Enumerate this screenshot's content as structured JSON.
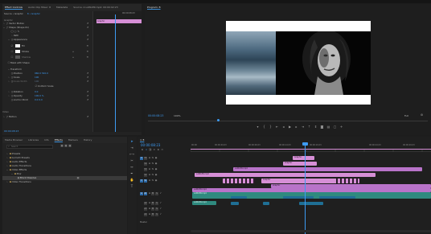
{
  "effect_controls": {
    "tabs": [
      "Effect Controls",
      "Audio Clip Mixer: 8",
      "Metadata",
      "Source: A LAWLER.mp4: 00:00:02:23"
    ],
    "source_label": "Source • Graphic",
    "sequence_label": "8 • Graphic",
    "mini_timecode": "00:00:08:23",
    "mini_clip_label": "Graphic",
    "section_label": "Graphic",
    "rows": [
      {
        "label": "Vector Motion"
      },
      {
        "label": "Shape (Shape 01)"
      },
      {
        "label": "Path"
      },
      {
        "label": "Appearance"
      },
      {
        "label": "Fill"
      },
      {
        "label": "Stroke"
      },
      {
        "label": "Shadow"
      },
      {
        "label": "Mask with Shape"
      },
      {
        "label": "Transform"
      },
      {
        "label": "Position",
        "value": "960.0  540.0"
      },
      {
        "label": "Scale",
        "value": "100"
      },
      {
        "label": "Scale Width",
        "value": "100"
      },
      {
        "label": "Uniform Scale"
      },
      {
        "label": "Rotation",
        "value": "0.0"
      },
      {
        "label": "Opacity",
        "value": "100.0 %"
      },
      {
        "label": "Anchor Point",
        "value": "0.0  0.0"
      }
    ],
    "bottom_labels": [
      "Video",
      "Motion"
    ],
    "footer_timecode": "00:00:08:23"
  },
  "program": {
    "tab": "Program: 8",
    "timecode": "00:00:08:23",
    "fit": "Fit",
    "zoom": "100%",
    "quality": "Full"
  },
  "project": {
    "tabs": [
      "Media Browser",
      "Libraries",
      "Info",
      "Effects",
      "Markers",
      "History"
    ],
    "search_placeholder": "Search",
    "items": [
      {
        "label": "Presets",
        "indent": 1
      },
      {
        "label": "Lumetri Presets",
        "indent": 1
      },
      {
        "label": "Audio Effects",
        "indent": 1
      },
      {
        "label": "Audio Transitions",
        "indent": 1
      },
      {
        "label": "Video Effects",
        "indent": 1
      },
      {
        "label": "Blur",
        "indent": 2
      },
      {
        "label": "Block Dissolve",
        "indent": 3,
        "selected": true
      },
      {
        "label": "Video Transitions",
        "indent": 1
      }
    ]
  },
  "timeline": {
    "tab": "8",
    "timecode": "00:00:08:23",
    "ruler_ticks": [
      "00:00",
      "00:00:04:23",
      "00:00:09:23",
      "00:00:14:23",
      "00:00:19:23",
      "00:00:24:23",
      "00:00:29:23"
    ],
    "video_tracks": [
      "V5",
      "V4",
      "V3",
      "V2",
      "V1"
    ],
    "audio_tracks": [
      "A1",
      "A2",
      "A3",
      "A4"
    ],
    "master": "Master",
    "clip_labels": {
      "graphic_a": "Graphic",
      "graphic_b": "Graphic",
      "graphic_c": "Graphic",
      "graphic_d": "Graphic",
      "lawler_a": "LAWLER.mp4",
      "lawler_b": "LAWLER.mp4",
      "lawler_c": "LAWLER.mp4",
      "audio_a": "LAWLER.mp4",
      "audio_b": "LAWLER.mp4"
    }
  },
  "colors": {
    "accent": "#3d9bf3",
    "clip_pink": "#d68fd6",
    "audio_teal": "#2f8a7f",
    "playhead": "#3d9bf3"
  }
}
